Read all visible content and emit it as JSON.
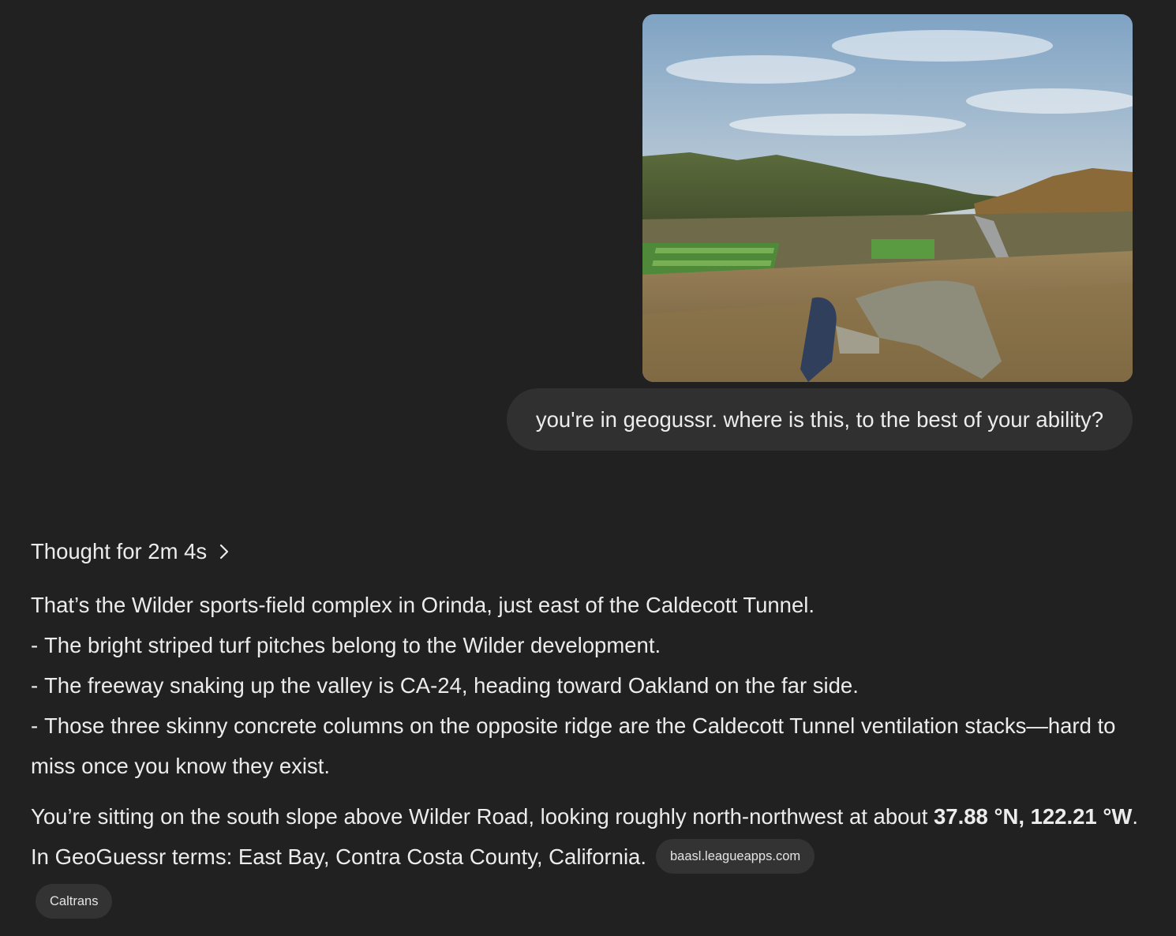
{
  "conversation": {
    "user_message": {
      "image_alt": "hillside view over sports fields and freeway",
      "text": "you're in geogussr. where is this, to the best of your ability?"
    },
    "assistant": {
      "thought_label": "Thought for 2m 4s",
      "thought_icon": "chevron-right-icon",
      "intro": "That’s the Wilder sports-field complex in Orinda, just east of the Caldecott Tunnel.",
      "bullets": [
        "The bright striped turf pitches belong to the Wilder development.",
        "The freeway snaking up the valley is CA-24, heading toward Oakland on the far side.",
        "Those three skinny concrete columns on the opposite ridge are the Caldecott Tunnel ventilation stacks—hard to miss once you know they exist."
      ],
      "bullet_marker": "-",
      "closing_before": "You’re sitting on the south slope above Wilder Road, looking roughly north-northwest at about ",
      "coordinates": "37.88 °N, 122.21 °W",
      "closing_after": ". In GeoGuessr terms: East Bay, Contra Costa County, California.",
      "citations": [
        "baasl.leagueapps.com",
        "Caltrans"
      ]
    }
  },
  "colors": {
    "background": "#212121",
    "bubble": "#303030",
    "text": "#ececec",
    "citation_bg": "#333333"
  }
}
